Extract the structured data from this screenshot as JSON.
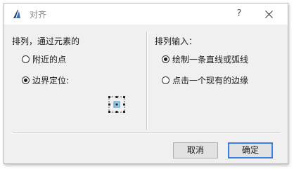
{
  "window": {
    "title": "对齐",
    "help_label": "?",
    "close_icon": "close-icon",
    "app_icon": "archicad-icon"
  },
  "left_group": {
    "label": "排列，通过元素的",
    "options": [
      {
        "label": "附近的点",
        "checked": false
      },
      {
        "label": "边界定位:",
        "checked": true
      }
    ],
    "anchor_icon": "anchor-grid-icon"
  },
  "right_group": {
    "label": "排列输入：",
    "options": [
      {
        "label": "绘制一条直线或弧线",
        "checked": true
      },
      {
        "label": "点击一个现有的边缘",
        "checked": false
      }
    ]
  },
  "buttons": {
    "cancel_label": "取消",
    "ok_label": "确定"
  },
  "colors": {
    "default_button_border": "#3c7ee6",
    "anchor_selected": "#9fd2ee"
  }
}
